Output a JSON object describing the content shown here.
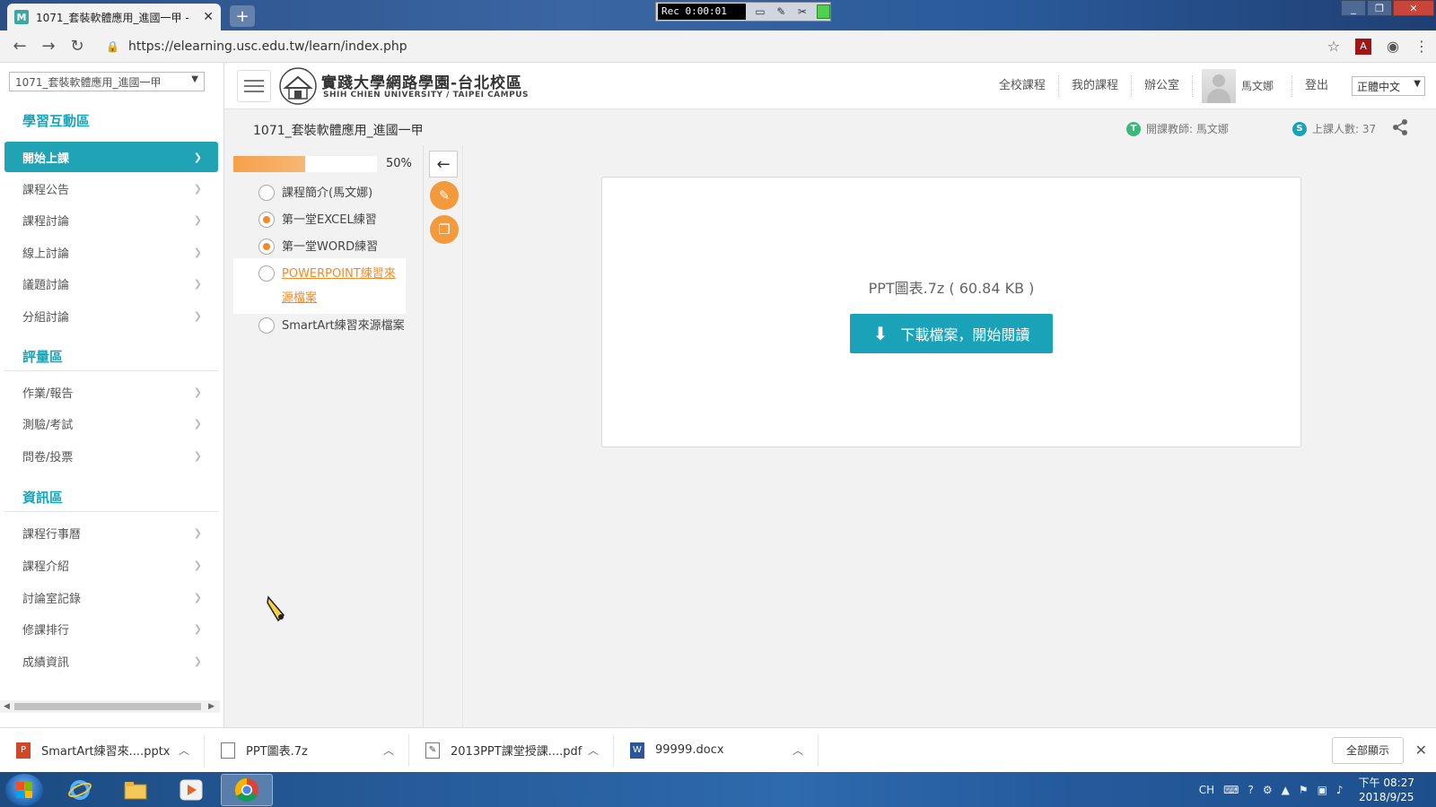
{
  "browser": {
    "tab_title": "1071_套裝軟體應用_進國一甲 - ",
    "tab_favicon": "M",
    "newtab_label": "+",
    "url": "https://elearning.usc.edu.tw/learn/index.php",
    "recorder": "Rec 0:00:01"
  },
  "sidebar": {
    "course_select": "1071_套裝軟體應用_進國一甲",
    "sections": [
      {
        "title": "學習互動區",
        "items": [
          "開始上課",
          "課程公告",
          "課程討論",
          "線上討論",
          "議題討論",
          "分組討論"
        ]
      },
      {
        "title": "評量區",
        "items": [
          "作業/報告",
          "測驗/考試",
          "問卷/投票"
        ]
      },
      {
        "title": "資訊區",
        "items": [
          "課程行事曆",
          "課程介紹",
          "討論室記錄",
          "修課排行",
          "成績資訊"
        ]
      }
    ]
  },
  "header": {
    "logo_cn": "實踐大學網路學園-台北校區",
    "logo_en": "SHIH CHIEN UNIVERSITY / TAIPEI CAMPUS",
    "nav": [
      "全校課程",
      "我的課程",
      "辦公室"
    ],
    "username": "馬文娜",
    "logout": "登出",
    "language": "正體中文"
  },
  "coursebar": {
    "title": "1071_套裝軟體應用_進國一甲",
    "teacher_badge": "T",
    "teacher_label": "開課教師: 馬文娜",
    "students_badge": "S",
    "students_label": "上課人數: 37"
  },
  "lessons": {
    "progress_percent": 50,
    "progress_label": "50%",
    "items": [
      {
        "label": "課程簡介(馬文娜)",
        "done": false
      },
      {
        "label": "第一堂EXCEL練習",
        "done": true
      },
      {
        "label": "第一堂WORD練習",
        "done": true
      },
      {
        "label": "POWERPOINT練習來源檔案",
        "done": false,
        "current": true
      },
      {
        "label": "SmartArt練習來源檔案",
        "done": false
      }
    ]
  },
  "content": {
    "filename": "PPT圖表.7z ( 60.84 KB )",
    "download_button": "下載檔案，開始閱讀"
  },
  "downloads": {
    "items": [
      {
        "name": "SmartArt練習來....pptx",
        "icon": "pptx-icon",
        "color": "#d24726"
      },
      {
        "name": "PPT圖表.7z",
        "icon": "file-icon",
        "color": "#ffffff"
      },
      {
        "name": "2013PPT課堂授課....pdf",
        "icon": "pdf-edit-icon",
        "color": "#ffffff"
      },
      {
        "name": "99999.docx",
        "icon": "docx-icon",
        "color": "#2b579a"
      }
    ],
    "show_all": "全部顯示"
  },
  "taskbar": {
    "input_method": "CH",
    "time": "下午 08:27",
    "date": "2018/9/25"
  },
  "colors": {
    "accent": "#1aa3b8",
    "orange": "#f28a2a"
  }
}
